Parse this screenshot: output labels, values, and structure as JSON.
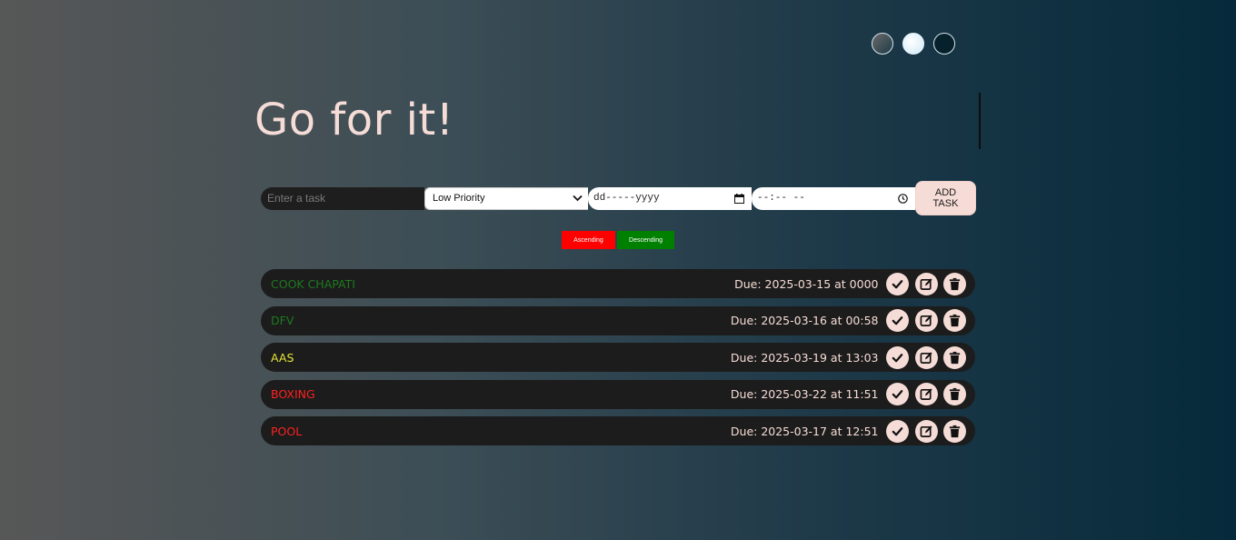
{
  "colors": {
    "accent": "#f6dcd6",
    "item_bg": "#1c1c1c",
    "low_priority": "#1f7a1f",
    "medium_priority": "#e5e53a",
    "high_priority": "#ff2020",
    "ascending_bg": "#ff0000",
    "descending_bg": "#008000"
  },
  "heading": "Go for it!",
  "form": {
    "task_placeholder": "Enter a task",
    "priority_selected": "Low Priority",
    "date_placeholder": "dd-----yyyy",
    "time_placeholder": "--:-- --",
    "add_button": "ADD TASK"
  },
  "sort": {
    "ascending": "Ascending",
    "descending": "Descending"
  },
  "tasks": [
    {
      "title": "COOK CHAPATI",
      "due": "Due: 2025-03-15 at 0000",
      "color": "#1f7a1f"
    },
    {
      "title": "DFV",
      "due": "Due: 2025-03-16 at 00:58",
      "color": "#1f7a1f"
    },
    {
      "title": "AAS",
      "due": "Due: 2025-03-19 at 13:03",
      "color": "#e5e53a"
    },
    {
      "title": "BOXING",
      "due": "Due: 2025-03-22 at 11:51",
      "color": "#ff2020"
    },
    {
      "title": "POOL",
      "due": "Due: 2025-03-17 at 12:51",
      "color": "#ff2020"
    }
  ],
  "icons": {
    "check": "check-icon",
    "edit": "edit-icon",
    "delete": "trash-icon"
  }
}
